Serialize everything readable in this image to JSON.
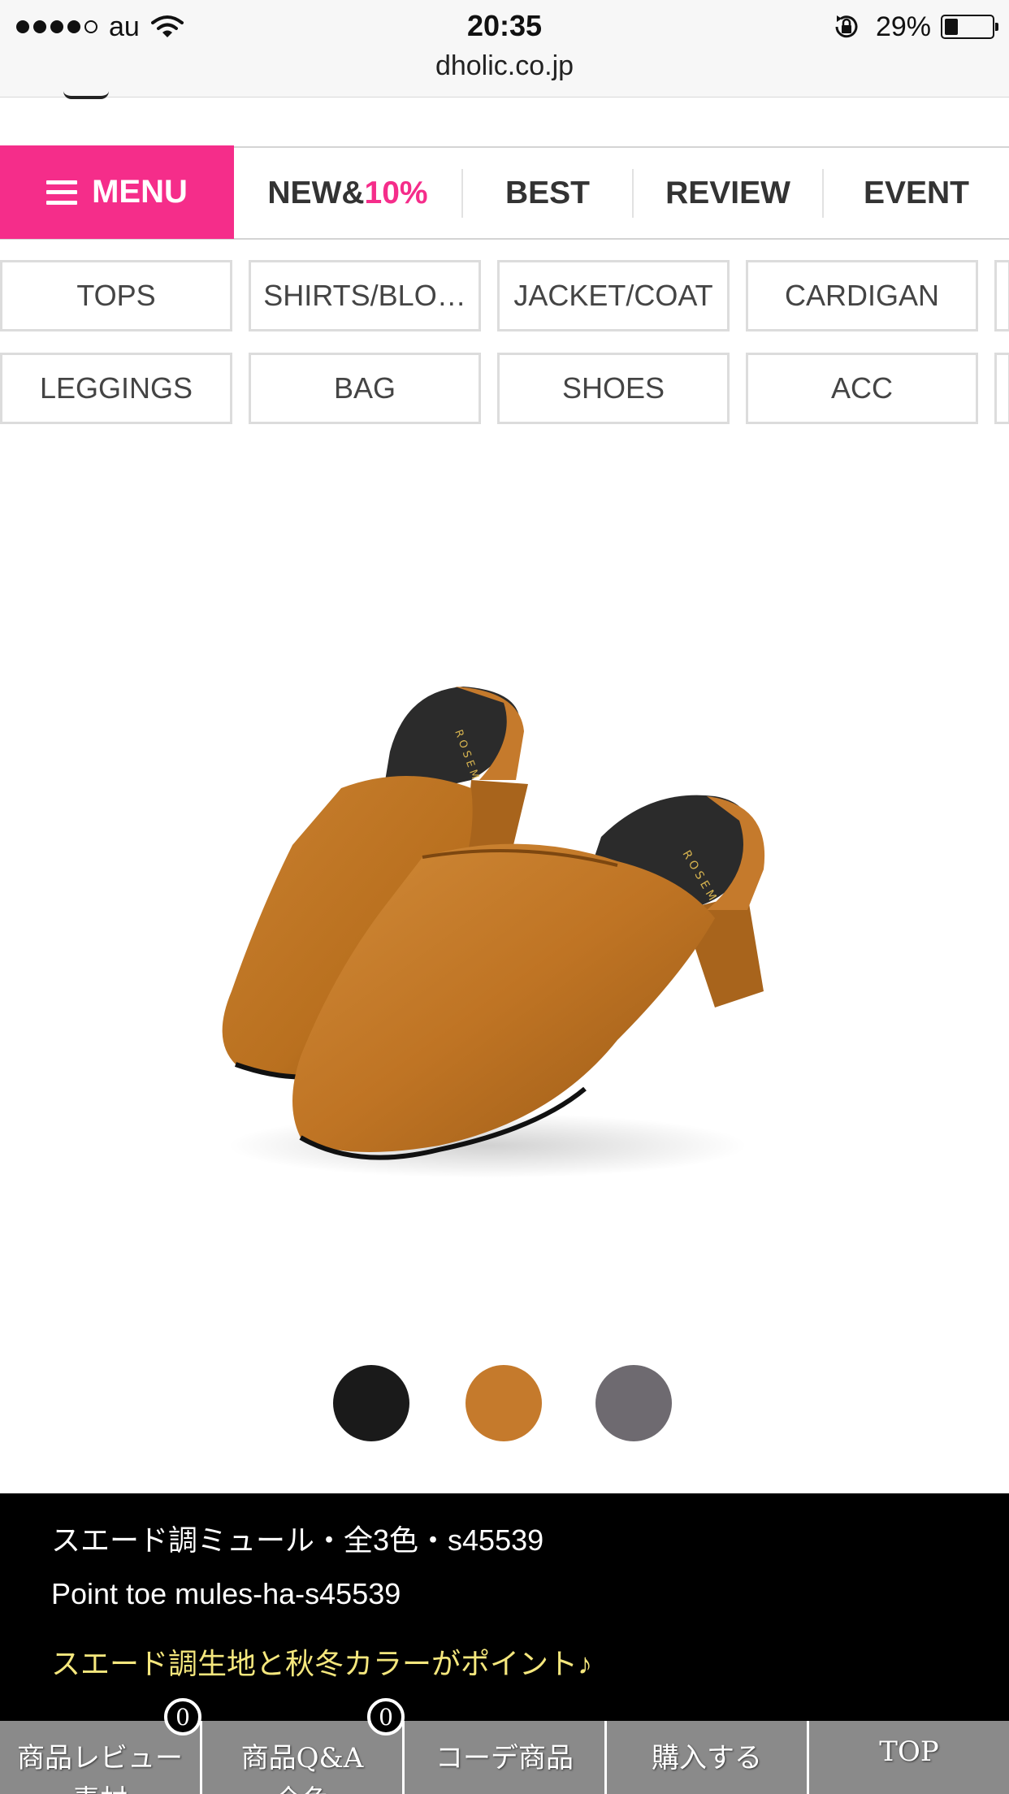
{
  "status_bar": {
    "carrier": "au",
    "time": "20:35",
    "battery_text": "29%",
    "battery_level": 0.29,
    "url": "dholic.co.jp"
  },
  "nav": {
    "menu_label": "MENU",
    "new_prefix": "NEW&",
    "new_highlight": "10%",
    "best": "BEST",
    "review": "REVIEW",
    "event": "EVENT",
    "accent_color": "#f52d8a"
  },
  "categories": {
    "row1": [
      "TOPS",
      "SHIRTS/BLO…",
      "JACKET/COAT",
      "CARDIGAN"
    ],
    "row2": [
      "LEGGINGS",
      "BAG",
      "SHOES",
      "ACC"
    ]
  },
  "product": {
    "image_alt_icon": "suede-mules-photo",
    "swatches": [
      {
        "name": "black",
        "color": "#1a1a1a"
      },
      {
        "name": "camel",
        "color": "#c57a2c"
      },
      {
        "name": "gray",
        "color": "#6e6a70"
      }
    ],
    "title": "スエード調ミュール・全3色・s45539",
    "subtitle": "Point toe mules-ha-s45539",
    "catchphrase": "スエード調生地と秋冬カラーがポイント♪"
  },
  "bottom_bar": {
    "review_label": "商品レビュー",
    "review_count": "0",
    "review_sub": "素材",
    "qa_label": "商品Q&A",
    "qa_count": "0",
    "qa_sub": "全色",
    "coord_label": "コーデ商品",
    "buy_label": "購入する",
    "top_label": "TOP"
  }
}
